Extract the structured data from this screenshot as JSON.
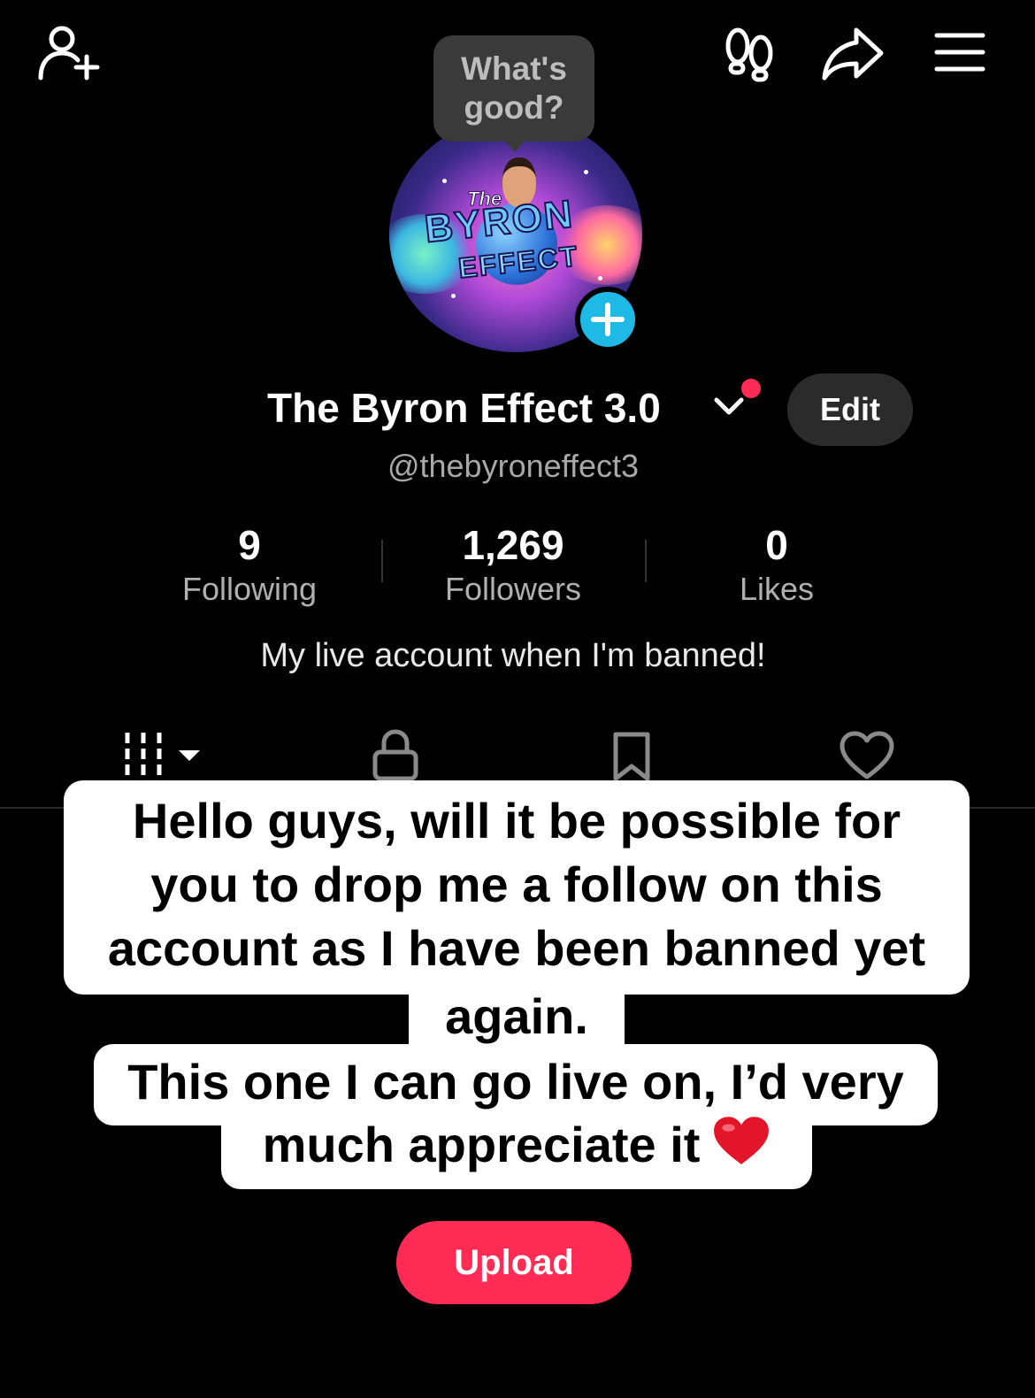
{
  "header": {
    "icons": [
      "add-friend-icon",
      "footprints-icon",
      "share-icon",
      "menu-icon"
    ]
  },
  "tooltip": {
    "text_line1": "What's",
    "text_line2": "good?"
  },
  "profile": {
    "avatar_text": {
      "the": "The",
      "byron": "BYRON",
      "effect": "EFFECT"
    },
    "name": "The Byron Effect 3.0",
    "handle": "@thebyroneffect3",
    "edit_label": "Edit",
    "bio": "My live account when I'm banned!"
  },
  "stats": [
    {
      "value": "9",
      "label": "Following"
    },
    {
      "value": "1,269",
      "label": "Followers"
    },
    {
      "value": "0",
      "label": "Likes"
    }
  ],
  "tabs": [
    "videos-grid-icon",
    "lock-icon",
    "bookmark-icon",
    "heart-icon"
  ],
  "caption": {
    "line1": "Hello guys, will it be possible for",
    "line2": "you to drop me a follow on this",
    "line3": "account as I have been banned yet",
    "line4": "again.",
    "line5": "This one I can go live on, I’d very",
    "line6": "much appreciate it"
  },
  "upload_label": "Upload",
  "colors": {
    "accent": "#fe2c55",
    "badge": "#1fb9e6",
    "background": "#000000"
  }
}
